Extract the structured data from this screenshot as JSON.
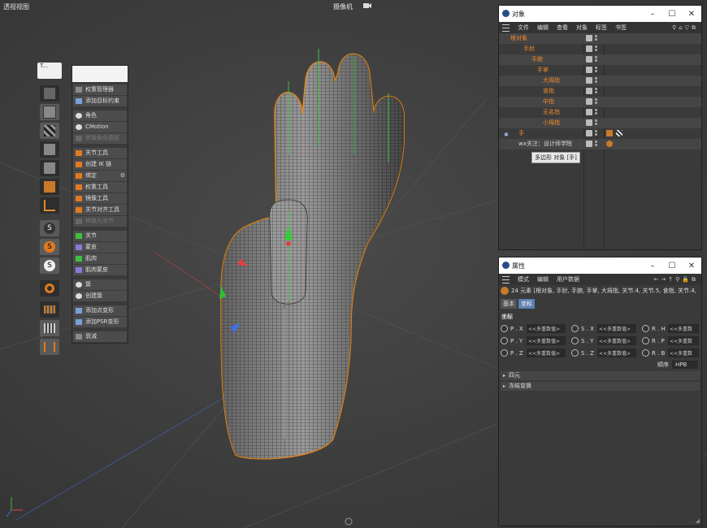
{
  "viewport": {
    "title": "透视视图",
    "camera": "摄像机",
    "bottom_icon": "grid-origin-icon"
  },
  "palette": {
    "top_label": "T...",
    "buttons": [
      "cube-icon",
      "checker-cube-icon",
      "cube-icon",
      "cube-icon",
      "cube-icon",
      "corner-icon",
      "s-icon",
      "s-orange-icon",
      "s-icon",
      "magnet-icon",
      "grid-icon",
      "lock-grid-icon",
      "grid-bracket-icon"
    ]
  },
  "character_menu": {
    "items": [
      {
        "label": "权重管理器",
        "enabled": true
      },
      {
        "label": "添加目标约束",
        "enabled": true
      },
      {
        "label": "角色",
        "enabled": true
      },
      {
        "label": "CMotion",
        "enabled": true
      },
      {
        "label": "转换角色模板",
        "enabled": false
      },
      {
        "label": "关节工具",
        "enabled": true
      },
      {
        "label": "创建 IK 链",
        "enabled": true
      },
      {
        "label": "绑定",
        "enabled": true
      },
      {
        "label": "权重工具",
        "enabled": true
      },
      {
        "label": "镜像工具",
        "enabled": true
      },
      {
        "label": "关节对齐工具",
        "enabled": true
      },
      {
        "label": "转换为关节",
        "enabled": false
      },
      {
        "label": "关节",
        "enabled": true
      },
      {
        "label": "蒙皮",
        "enabled": true
      },
      {
        "label": "肌肉",
        "enabled": true
      },
      {
        "label": "肌肉蒙皮",
        "enabled": true
      },
      {
        "label": "簇",
        "enabled": true
      },
      {
        "label": "创建簇",
        "enabled": true
      },
      {
        "label": "添加点变形",
        "enabled": true
      },
      {
        "label": "添加PSR变形",
        "enabled": true
      },
      {
        "label": "衰减",
        "enabled": true
      }
    ]
  },
  "object_manager": {
    "title": "对象",
    "menu": [
      "文件",
      "编辑",
      "查看",
      "对象",
      "标签",
      "书签"
    ],
    "rows": [
      {
        "name": "根对象",
        "depth": 0,
        "color": "orange"
      },
      {
        "name": "手肘",
        "depth": 1,
        "color": "orange"
      },
      {
        "name": "手腕",
        "depth": 2,
        "color": "orange"
      },
      {
        "name": "手掌",
        "depth": 3,
        "color": "orange"
      },
      {
        "name": "大拇指",
        "depth": 4,
        "color": "orange"
      },
      {
        "name": "食指",
        "depth": 4,
        "color": "orange"
      },
      {
        "name": "中指",
        "depth": 4,
        "color": "orange"
      },
      {
        "name": "无名指",
        "depth": 4,
        "color": "orange"
      },
      {
        "name": "小拇指",
        "depth": 4,
        "color": "orange"
      },
      {
        "name": "手",
        "depth": 0,
        "color": "orange"
      },
      {
        "name": "wx关注：设计师学院",
        "depth": 0,
        "color": "white"
      }
    ],
    "tooltip": "多边形 对象 [手]"
  },
  "attribute_manager": {
    "title": "属性",
    "menu": [
      "模式",
      "编辑",
      "用户数据"
    ],
    "summary": "24 元素 [根对象, 手肘, 手腕, 手掌, 大拇指, 关节.4, 关节.5, 食指, 关节.4,",
    "tabs": [
      {
        "label": "基本",
        "active": false
      },
      {
        "label": "坐标",
        "active": true
      }
    ],
    "section_title": "坐标",
    "coords": [
      [
        {
          "label": "P . X",
          "value": "<<多重数值>"
        },
        {
          "label": "S . X",
          "value": "<<多重数值>"
        },
        {
          "label": "R . H",
          "value": "<<多重数"
        }
      ],
      [
        {
          "label": "P . Y",
          "value": "<<多重数值>"
        },
        {
          "label": "S . Y",
          "value": "<<多重数值>"
        },
        {
          "label": "R . P",
          "value": "<<多重数"
        }
      ],
      [
        {
          "label": "P . Z",
          "value": "<<多重数值>"
        },
        {
          "label": "S . Z",
          "value": "<<多重数值>"
        },
        {
          "label": "R . B",
          "value": "<<多重数"
        }
      ]
    ],
    "order_label": "顺序",
    "order_value": "HPB",
    "sections": [
      "四元",
      "冻结变换"
    ]
  }
}
